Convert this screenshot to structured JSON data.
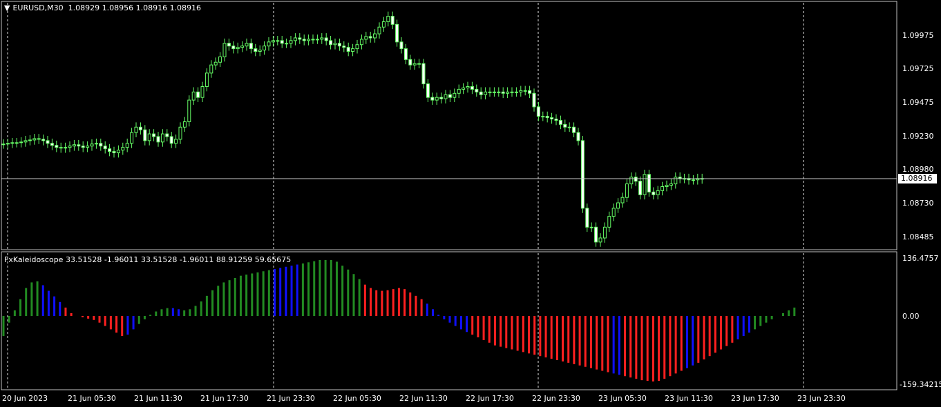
{
  "main_title": {
    "symbol_timeframe": "EURUSD,M30",
    "ohlc": "1.08929 1.08956 1.08916 1.08916"
  },
  "indicator_title": "FxKaleidoscope 33.51528 -1.96011 33.51528 -1.96011 88.91259 59.65675",
  "current_price": "1.08916",
  "price_axis": [
    "1.09975",
    "1.09725",
    "1.09475",
    "1.09230",
    "1.08980",
    "1.08730",
    "1.08485"
  ],
  "indicator_axis": [
    "136.4757",
    "0.00",
    "-159.34215"
  ],
  "time_axis": [
    "20 Jun 2023",
    "21 Jun 05:30",
    "21 Jun 11:30",
    "21 Jun 17:30",
    "21 Jun 23:30",
    "22 Jun 05:30",
    "22 Jun 11:30",
    "22 Jun 17:30",
    "22 Jun 23:30",
    "23 Jun 05:30",
    "23 Jun 11:30",
    "23 Jun 17:30",
    "23 Jun 23:30"
  ],
  "colors": {
    "background": "#000000",
    "candle": "#66ff66",
    "grid": "#ffffff",
    "hist_up": "#228b22",
    "hist_red": "#ff2020",
    "hist_blue": "#1010ff"
  },
  "chart_data": {
    "type": "candlestick",
    "symbol": "EURUSD",
    "timeframe": "M30",
    "closes": [
      1.09175,
      1.0918,
      1.09185,
      1.09185,
      1.0919,
      1.092,
      1.09205,
      1.09215,
      1.0921,
      1.092,
      1.0918,
      1.09165,
      1.0915,
      1.09145,
      1.0915,
      1.0916,
      1.0917,
      1.0916,
      1.0915,
      1.0916,
      1.09175,
      1.0918,
      1.0916,
      1.0914,
      1.0912,
      1.0911,
      1.0913,
      1.0915,
      1.0918,
      1.0926,
      1.093,
      1.0928,
      1.092,
      1.0925,
      1.0923,
      1.0919,
      1.0925,
      1.0923,
      1.0918,
      1.0921,
      1.093,
      1.0934,
      1.095,
      1.0956,
      1.0952,
      1.096,
      1.097,
      1.0976,
      1.0978,
      1.0982,
      1.0992,
      1.099,
      1.0988,
      1.0989,
      1.099,
      1.0992,
      1.0988,
      1.0986,
      1.0987,
      1.099,
      1.0993,
      1.0994,
      1.0994,
      1.0992,
      1.0992,
      1.0994,
      1.0996,
      1.0995,
      1.0994,
      1.0995,
      1.0995,
      1.0995,
      1.0996,
      1.0994,
      1.0991,
      1.0992,
      1.099,
      1.0989,
      1.0986,
      1.0988,
      1.0991,
      1.0995,
      1.0997,
      1.0996,
      1.0999,
      1.1004,
      1.1008,
      1.1012,
      1.1006,
      1.0993,
      1.0988,
      1.098,
      1.0976,
      1.0977,
      1.0977,
      1.0962,
      1.0952,
      1.095,
      1.0952,
      1.0951,
      1.0954,
      1.0952,
      1.0955,
      1.0958,
      1.0959,
      1.096,
      1.0958,
      1.0956,
      1.0954,
      1.0956,
      1.0956,
      1.0956,
      1.0956,
      1.0955,
      1.0956,
      1.0956,
      1.0956,
      1.0957,
      1.0957,
      1.0955,
      1.0945,
      1.0938,
      1.0938,
      1.0937,
      1.0936,
      1.0935,
      1.0932,
      1.093,
      1.093,
      1.0926,
      1.092,
      1.087,
      1.0856,
      1.0856,
      1.0845,
      1.0848,
      1.0856,
      1.0864,
      1.087,
      1.0874,
      1.0878,
      1.0888,
      1.0893,
      1.089,
      1.088,
      1.0895,
      1.0882,
      1.088,
      1.0883,
      1.0886,
      1.0887,
      1.0888,
      1.0893,
      1.0892,
      1.0892,
      1.0891,
      1.0891,
      1.0892,
      1.08916
    ],
    "hist": [
      -0.3,
      -0.1,
      0.1,
      0.3,
      0.5,
      0.6,
      0.62,
      0.55,
      0.45,
      0.35,
      0.25,
      0.15,
      0.05,
      0.0,
      -0.02,
      -0.04,
      -0.06,
      -0.1,
      -0.15,
      -0.2,
      -0.25,
      -0.3,
      -0.28,
      -0.2,
      -0.12,
      -0.05,
      0.02,
      0.08,
      0.12,
      0.14,
      0.14,
      0.12,
      0.1,
      0.12,
      0.18,
      0.26,
      0.36,
      0.46,
      0.54,
      0.6,
      0.64,
      0.68,
      0.72,
      0.74,
      0.76,
      0.78,
      0.8,
      0.82,
      0.84,
      0.86,
      0.88,
      0.9,
      0.92,
      0.94,
      0.96,
      0.98,
      1.0,
      1.0,
      1.0,
      0.97,
      0.9,
      0.83,
      0.75,
      0.66,
      0.56,
      0.5,
      0.46,
      0.45,
      0.46,
      0.48,
      0.5,
      0.48,
      0.42,
      0.36,
      0.3,
      0.22,
      0.12,
      0.02,
      -0.05,
      -0.1,
      -0.15,
      -0.2,
      -0.24,
      -0.28,
      -0.32,
      -0.36,
      -0.4,
      -0.44,
      -0.46,
      -0.48,
      -0.5,
      -0.52,
      -0.54,
      -0.56,
      -0.58,
      -0.6,
      -0.62,
      -0.64,
      -0.66,
      -0.68,
      -0.7,
      -0.72,
      -0.74,
      -0.76,
      -0.78,
      -0.8,
      -0.82,
      -0.84,
      -0.86,
      -0.88,
      -0.9,
      -0.92,
      -0.94,
      -0.96,
      -0.97,
      -0.98,
      -0.97,
      -0.94,
      -0.9,
      -0.86,
      -0.82,
      -0.78,
      -0.74,
      -0.7,
      -0.65,
      -0.6,
      -0.55,
      -0.5,
      -0.45,
      -0.4,
      -0.35,
      -0.3,
      -0.25,
      -0.2,
      -0.15,
      -0.1,
      -0.05,
      0.0,
      0.05,
      0.1,
      0.15
    ],
    "hist_colors": "GGGGGGGBBBBRRRRRRRRRRRBBGGGGGGBBGGGGGGGGGGGGGGGGBBBBBGGGGGGGGGGGRRRRRRRRRRRBBBBBBBBRRRRRRRRRRRRRRRRRRRRRRRRRBBRRRRRRRRRRRBBRRRRRRRBBBGGGGGGGGGGGGGGGGGGGGGGGG"
  }
}
